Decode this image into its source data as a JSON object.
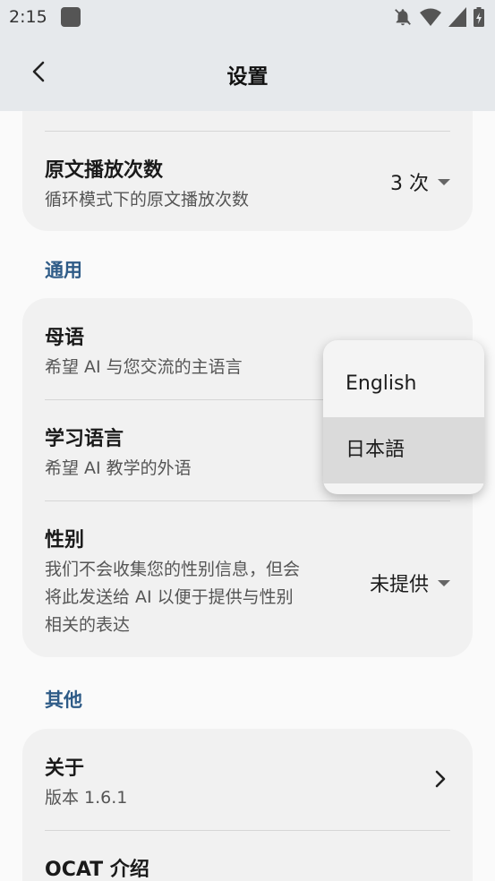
{
  "status": {
    "time": "2:15"
  },
  "appbar": {
    "title": "设置"
  },
  "playback": {
    "title": "原文播放次数",
    "subtitle": "循环模式下的原文播放次数",
    "value": "3 次"
  },
  "general": {
    "section_title": "通用",
    "native_language": {
      "title": "母语",
      "subtitle": "希望 AI 与您交流的主语言"
    },
    "learning_language": {
      "title": "学习语言",
      "subtitle": "希望 AI 教学的外语"
    },
    "gender": {
      "title": "性别",
      "subtitle_lines": [
        "我们不会收集您的性别信息，但会",
        "将此发送给 AI 以便于提供与性别",
        "相关的表达"
      ],
      "value": "未提供"
    }
  },
  "other": {
    "section_title": "其他",
    "about": {
      "title": "关于",
      "subtitle": "版本 1.6.1"
    },
    "intro": {
      "title": "OCAT 介绍"
    }
  },
  "language_menu": {
    "options": [
      "English",
      "日本語"
    ],
    "highlighted": "日本語"
  }
}
